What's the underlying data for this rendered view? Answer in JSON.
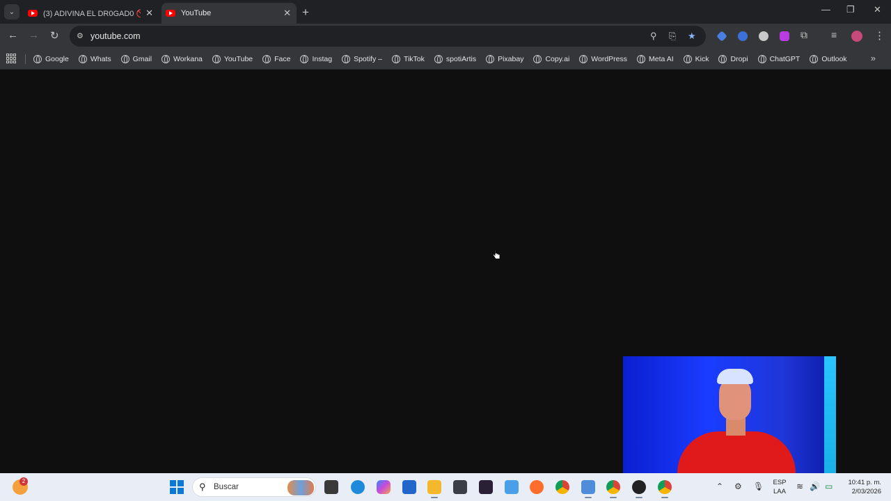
{
  "browser": {
    "tabs": [
      {
        "title": "(3) ADIVINA EL DR0GAD0 🚫 -",
        "active": false
      },
      {
        "title": "YouTube",
        "active": true
      }
    ],
    "address": "youtube.com",
    "bookmarks": [
      "Google",
      "Whats",
      "Gmail",
      "Workana",
      "YouTube",
      "Face",
      "Instag",
      "Spotify –",
      "TikTok",
      "spotiArtis",
      "Pixabay",
      "Copy.ai",
      "WordPress",
      "Meta AI",
      "Kick",
      "Dropi",
      "ChatGPT",
      "Outlook"
    ],
    "icons": {
      "tab_search": "chevron-down-icon",
      "new_tab": "plus-icon",
      "back": "arrow-left-icon",
      "forward": "arrow-right-icon",
      "reload": "reload-icon",
      "bookmark_star": "star-icon",
      "extensions": "puzzle-icon",
      "overflow": "chevron-double-right-icon"
    },
    "colors": {
      "tabstrip": "#202124",
      "toolbar": "#35363a",
      "page": "#0f0f0f",
      "star": "#8ab4f8",
      "youtube": "#ff0000"
    }
  },
  "taskbar": {
    "widget_badge": "2",
    "search_label": "Buscar",
    "language": {
      "line1": "ESP",
      "line2": "LAA"
    },
    "clock": {
      "time": "10:41 p. m.",
      "date": "2/03/2026"
    }
  }
}
